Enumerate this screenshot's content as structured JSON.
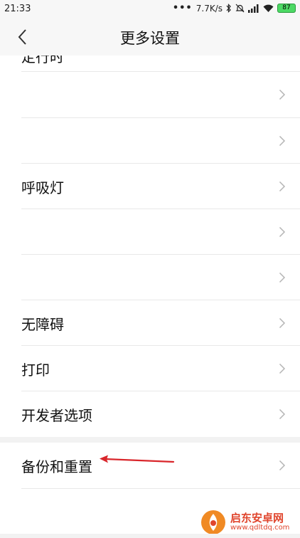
{
  "status_bar": {
    "time": "21:33",
    "dots": "•••",
    "speed": "7.7K/s",
    "battery": "87"
  },
  "header": {
    "title": "更多设置"
  },
  "list": {
    "partial_label": "定行时",
    "items": [
      {
        "label": ""
      },
      {
        "label": ""
      },
      {
        "label": "呼吸灯"
      },
      {
        "label": ""
      },
      {
        "label": ""
      },
      {
        "label": "无障碍"
      },
      {
        "label": "打印"
      },
      {
        "label": "开发者选项"
      },
      {
        "label": "备份和重置"
      }
    ]
  },
  "watermark": {
    "title": "启东安卓网",
    "url": "www.qdltdq.com"
  },
  "colors": {
    "annotation": "#d9262b",
    "battery": "#4cd964",
    "watermark": "#e0452d"
  }
}
